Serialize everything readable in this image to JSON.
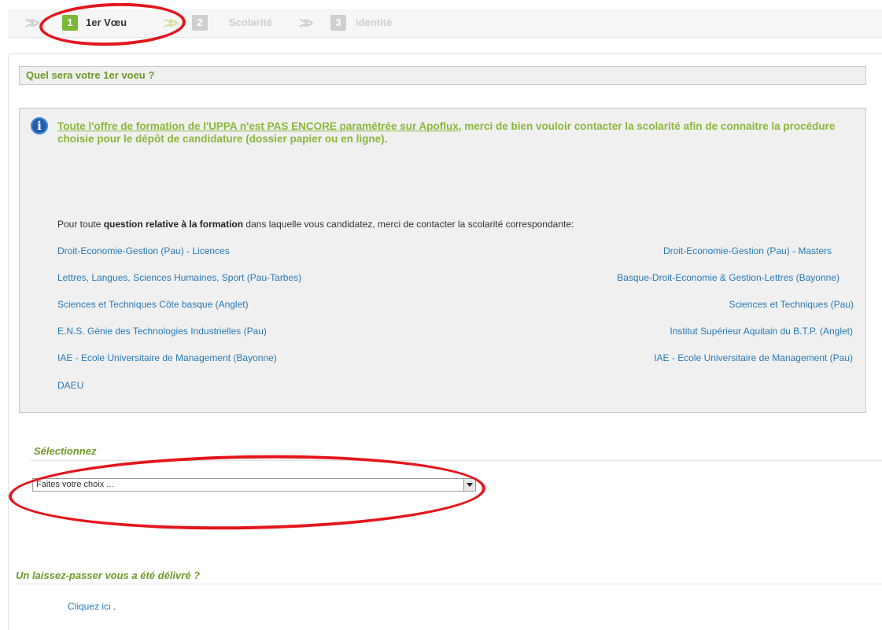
{
  "steps": [
    {
      "number": "1",
      "label": "1er Vœu",
      "active": true
    },
    {
      "number": "2",
      "label": "Scolarité",
      "active": false
    },
    {
      "number": "3",
      "label": "identité",
      "active": false
    }
  ],
  "question_title": "Quel sera votre 1er voeu ?",
  "info": {
    "link_text": "Toute l'offre de formation de l'UPPA n'est PAS ENCORE paramétrée sur Apoflux",
    "rest_text": ", merci de bien vouloir contacter la scolarité afin de connaitre la procédure choisie pour le dépôt de candidature (dossier papier ou en ligne).",
    "contact_prefix": "Pour toute ",
    "contact_bold": "question relative à la formation",
    "contact_suffix": " dans laquelle vous candidatez, merci de contacter la scolarité correspondante:",
    "links_left": [
      "Droit-Economie-Gestion (Pau) - Licences",
      "Lettres, Langues, Sciences Humaines, Sport (Pau-Tarbes)",
      "Sciences et Techniques Côte basque (Anglet)",
      "E.N.S. Génie des Technologies Industrielles (Pau)",
      "IAE - Ecole Universitaire de Management (Bayonne)",
      "DAEU"
    ],
    "links_right": [
      "Droit-Economie-Gestion (Pau) - Masters",
      "Basque-Droit-Economie & Gestion-Lettres (Bayonne)",
      "Sciences et Techniques (Pau)",
      "Institut Supérieur Aquitain du B.T.P. (Anglet)",
      "IAE - Ecole Universitaire de Management (Pau)"
    ]
  },
  "select_section": {
    "heading": "Sélectionnez",
    "selected_value": "Faites votre choix ..."
  },
  "pass_section": {
    "heading": "Un laissez-passer vous a été délivré ?",
    "link_text": "Cliquez ici",
    "suffix": "."
  },
  "colors": {
    "accent_green": "#7ab83a",
    "heading_green": "#6e9a2a",
    "link_blue": "#2a7ab8",
    "annotation_red": "#e3161c"
  }
}
